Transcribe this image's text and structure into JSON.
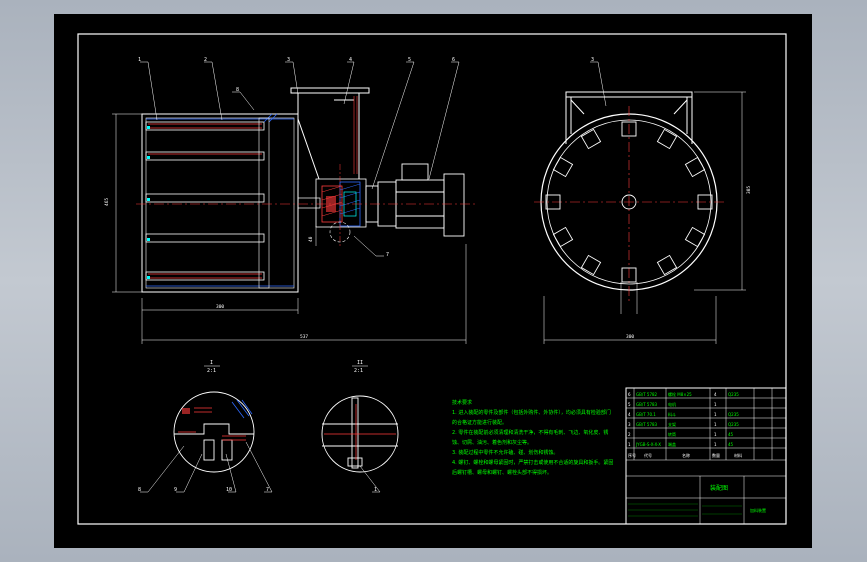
{
  "drawing": {
    "side_view": {
      "part_labels": [
        "1",
        "2",
        "3",
        "4",
        "5",
        "6"
      ],
      "extra_labels": [
        "8",
        "7"
      ],
      "dim_height": "465",
      "dim_flange": "40",
      "dim_body_length": "300",
      "dim_total_length": "537",
      "detail_marker": "I"
    },
    "front_view": {
      "part_label": "3",
      "dim_height": "305",
      "dim_width": "300"
    },
    "detail_i": {
      "title": "I",
      "scale": "2:1",
      "labels": [
        "8",
        "9",
        "10",
        "7"
      ]
    },
    "detail_ii": {
      "title": "II",
      "scale": "2:1",
      "labels": [
        "1"
      ]
    },
    "tech_notes": {
      "title": "技术要求",
      "lines": [
        "1. 进入装配的零件及部件（包括外购件、外协件），均必须具有检验部门",
        "的合格证方能进行装配。",
        "2. 零件在装配前必须清理和清洗干净，不得有毛刺、飞边、氧化皮、锈",
        "蚀、切屑、油污、着色剂和灰尘等。",
        "3. 装配过程中零件不允许磕、碰、划伤和锈蚀。",
        "4. 螺钉、螺栓和螺母紧固时，严禁打击或使用不合适的旋具和扳手。紧固",
        "后螺钉槽、螺母和螺钉、螺栓头部不得损坏。"
      ]
    },
    "title_block": {
      "drawing_name": "装配图",
      "school": "加料装置",
      "rows": [
        [
          "6",
          "GB/T 5782",
          "螺栓 M8×25",
          "4",
          "Q235"
        ],
        [
          "5",
          "GB/T 5783",
          "电机",
          "1",
          ""
        ],
        [
          "4",
          "GB/T 70.1",
          "料斗",
          "1",
          "Q235"
        ],
        [
          "3",
          "GB/T 5783",
          "支架",
          "1",
          "Q235"
        ],
        [
          "2",
          "",
          "转筒",
          "1",
          "45"
        ],
        [
          "1",
          "JYGB-S-X-X-X",
          "端盖",
          "1",
          "45"
        ]
      ],
      "header": [
        "序号",
        "代号",
        "名称",
        "数量",
        "材料"
      ]
    }
  }
}
